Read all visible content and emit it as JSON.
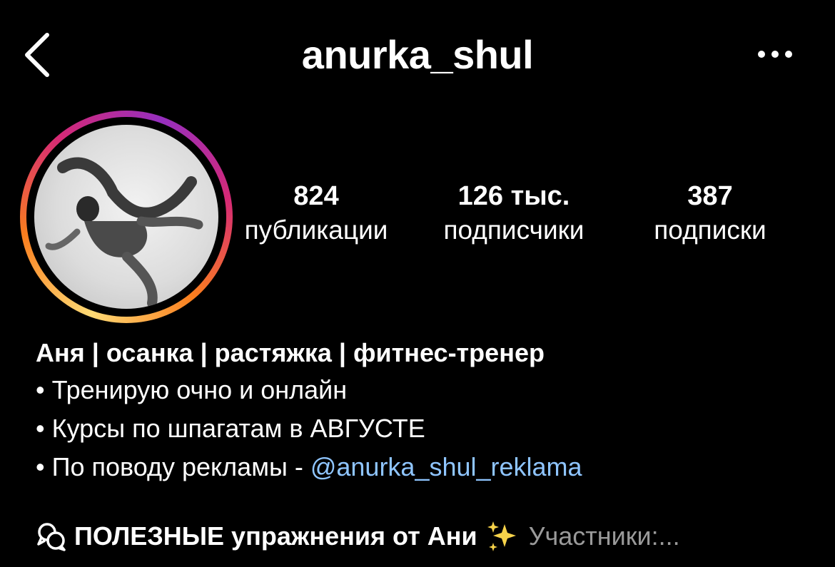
{
  "header": {
    "username": "anurka_shul",
    "back_icon": "chevron-left-icon",
    "more_icon": "more-horizontal-icon"
  },
  "profile": {
    "avatar_alt": "profile photo",
    "story_ring_colors": [
      "#feda75",
      "#fa7e1e",
      "#d62976",
      "#962fbf"
    ]
  },
  "stats": {
    "posts": {
      "value": "824",
      "label": "публикации"
    },
    "followers": {
      "value": "126 тыс.",
      "label": "подписчики"
    },
    "following": {
      "value": "387",
      "label": "подписки"
    }
  },
  "bio": {
    "name": "Аня | осанка | растяжка | фитнес-тренер",
    "bullet": "•",
    "line1": "Тренирую очно и онлайн",
    "line2": "Курсы по шпагатам в АВГУСТЕ",
    "line3_text": "По поводу рекламы - ",
    "line3_mention": "@anurka_shul_reklama",
    "mention_color": "#8fc5ff"
  },
  "community": {
    "icon": "community-chat-icon",
    "title": "ПОЛЕЗНЫЕ упражнения от Ани",
    "sparkle": "sparkles-icon",
    "subtitle": "Участники:..."
  }
}
